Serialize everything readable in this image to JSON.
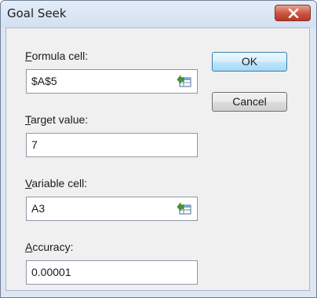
{
  "window": {
    "title": "Goal Seek"
  },
  "fields": {
    "formula_cell": {
      "label_key": "F",
      "label_rest": "ormula cell:",
      "value": "$A$5"
    },
    "target_value": {
      "label_key": "T",
      "label_rest": "arget value:",
      "value": "7"
    },
    "variable_cell": {
      "label_key": "V",
      "label_rest": "ariable cell:",
      "value": "A3"
    },
    "accuracy": {
      "label_key": "A",
      "label_rest": "ccuracy:",
      "value": "0.00001"
    }
  },
  "buttons": {
    "ok": "OK",
    "cancel": "Cancel"
  },
  "icons": {
    "close": "close-icon",
    "range_selector": "range-selector-icon"
  },
  "colors": {
    "close_button": "#c9533f",
    "default_button_border": "#3c7fb1"
  }
}
